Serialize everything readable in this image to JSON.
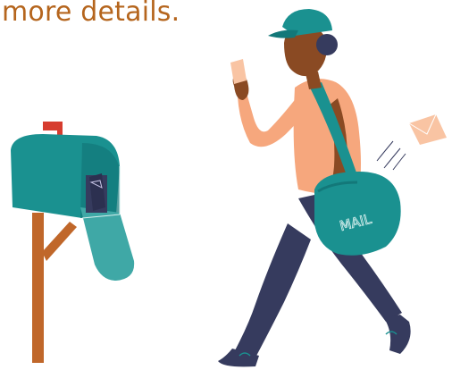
{
  "heading": {
    "text": "more details.",
    "color": "#b5651d"
  },
  "illustration": {
    "bag_label": "MAIL",
    "colors": {
      "teal": "#1a9190",
      "teal_dark": "#137879",
      "teal_light": "#3fa8a6",
      "navy": "#363b5e",
      "skin": "#8a4a23",
      "shirt": "#f6a77d",
      "mailbox_post": "#c0672a",
      "flag_red": "#d63c2e",
      "envelope": "#f9c4a3"
    }
  }
}
